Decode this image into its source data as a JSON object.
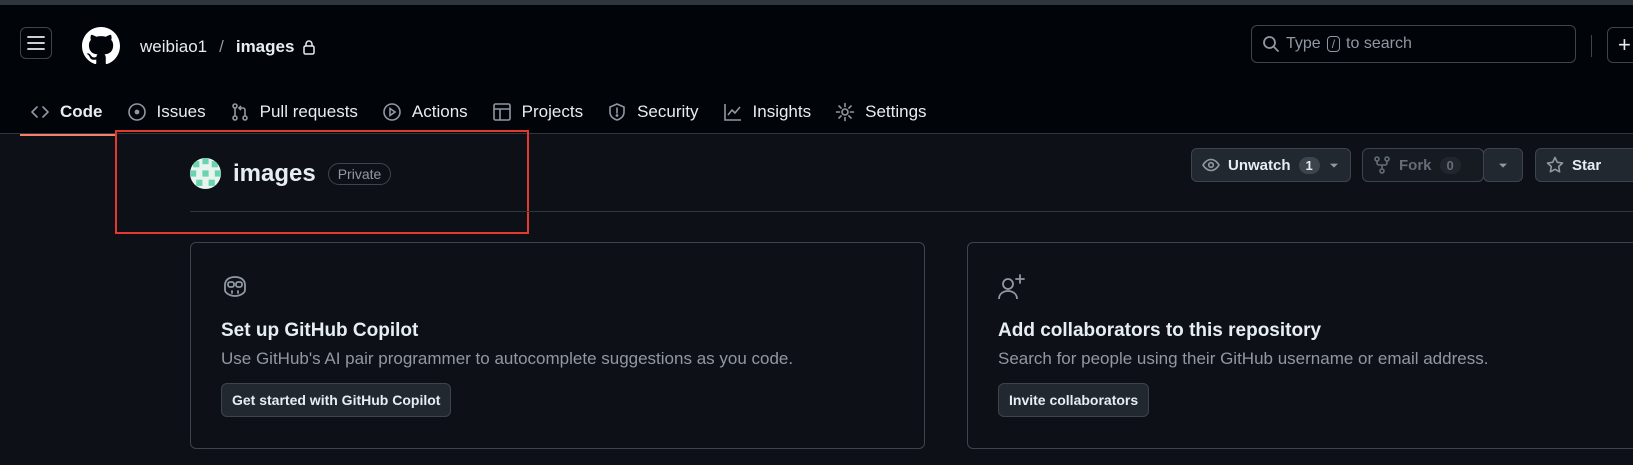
{
  "header": {
    "owner": "weibiao1",
    "separator": "/",
    "repo": "images",
    "search": {
      "prefix": "Type",
      "key": "/",
      "suffix": "to search"
    },
    "plus": "+"
  },
  "nav": {
    "tabs": [
      {
        "label": "Code",
        "icon": "code-icon",
        "active": true
      },
      {
        "label": "Issues",
        "icon": "issue-icon"
      },
      {
        "label": "Pull requests",
        "icon": "pull-request-icon"
      },
      {
        "label": "Actions",
        "icon": "play-icon"
      },
      {
        "label": "Projects",
        "icon": "table-icon"
      },
      {
        "label": "Security",
        "icon": "shield-icon"
      },
      {
        "label": "Insights",
        "icon": "graph-icon"
      },
      {
        "label": "Settings",
        "icon": "gear-icon"
      }
    ]
  },
  "repo_header": {
    "title": "images",
    "visibility": "Private",
    "unwatch_label": "Unwatch",
    "watch_count": "1",
    "fork_label": "Fork",
    "fork_count": "0",
    "star_label": "Star"
  },
  "cards": {
    "copilot": {
      "title": "Set up GitHub Copilot",
      "description": "Use GitHub's AI pair programmer to autocomplete suggestions as you code.",
      "button": "Get started with GitHub Copilot"
    },
    "collaborators": {
      "title": "Add collaborators to this repository",
      "description": "Search for people using their GitHub username or email address.",
      "button": "Invite collaborators"
    }
  },
  "colors": {
    "background": "#0d1117",
    "header_bg": "#010409",
    "active_tab_underline": "#f78166",
    "annotation_box": "#e5382f",
    "avatar_accent": "#6cd3b0"
  }
}
